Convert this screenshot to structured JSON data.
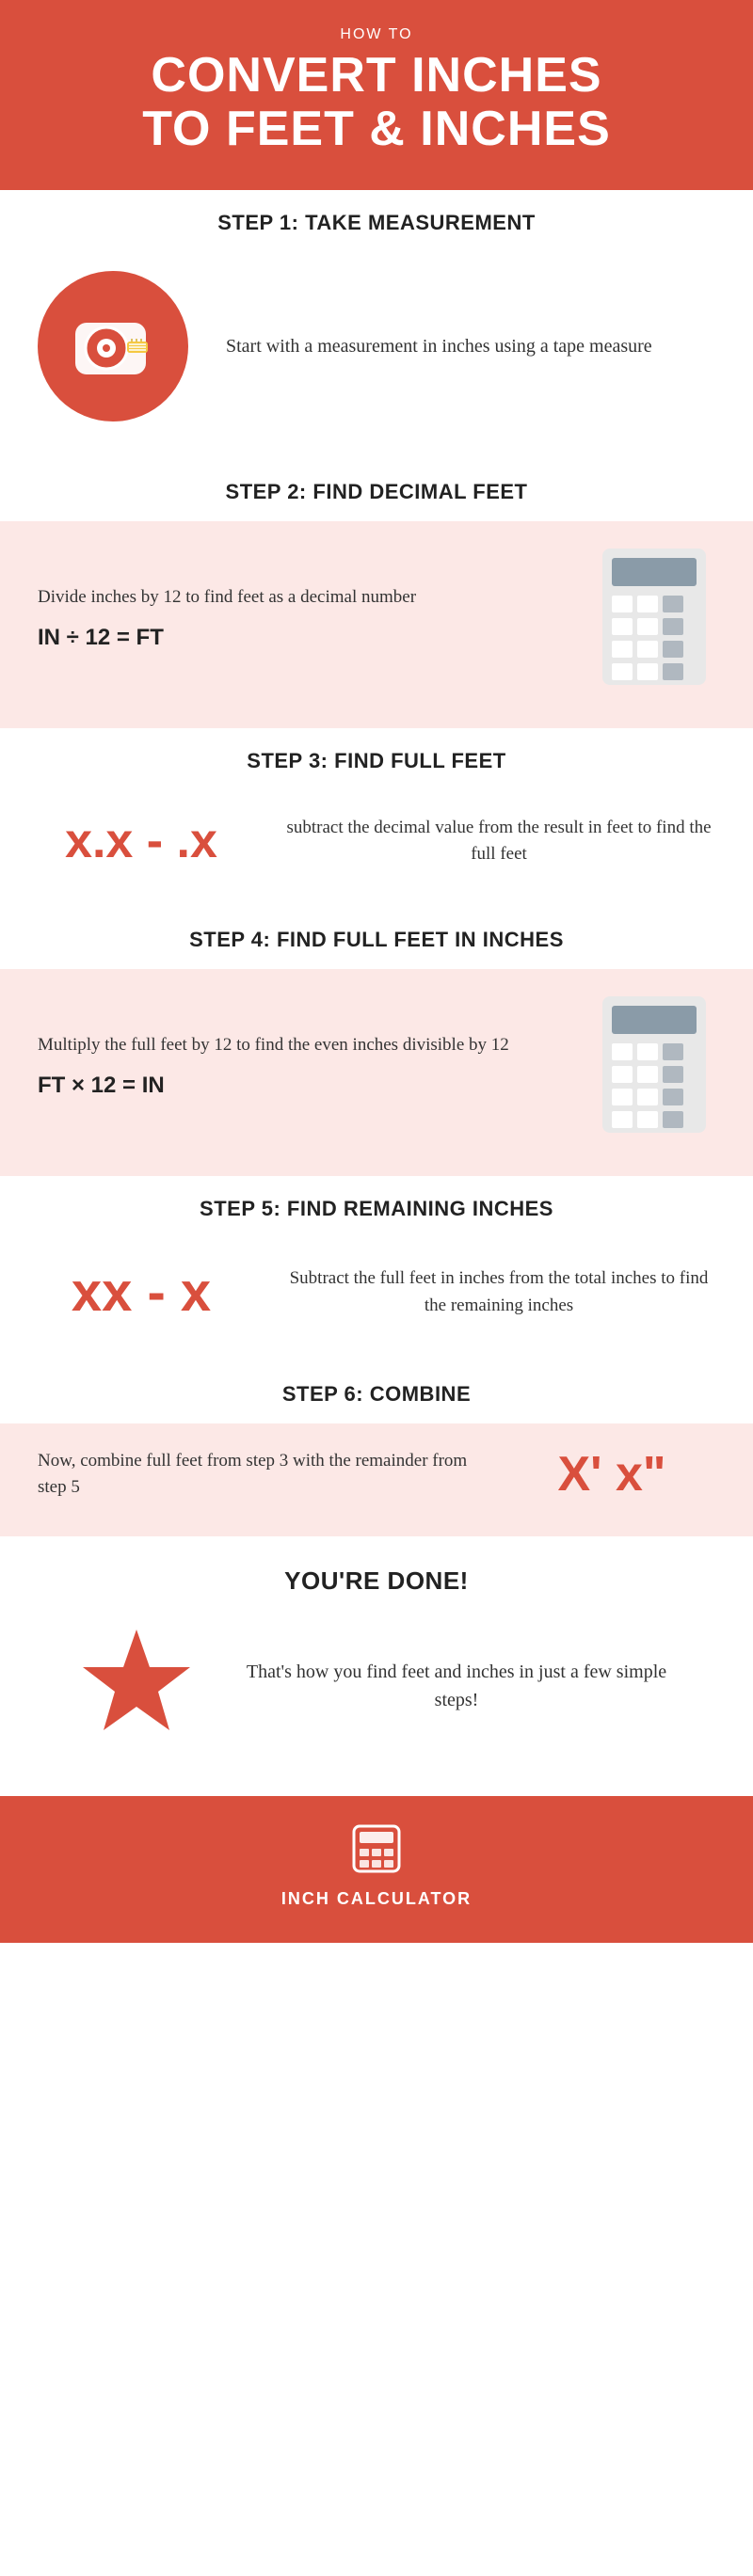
{
  "header": {
    "subtitle": "HOW TO",
    "title_line1": "CONVERT INCHES",
    "title_line2": "TO FEET & INCHES"
  },
  "steps": [
    {
      "number": "STEP 1:",
      "title": "TAKE MEASUREMENT",
      "body": "Start with a measurement in inches using a tape measure",
      "formula": null
    },
    {
      "number": "STEP 2:",
      "title": "FIND DECIMAL FEET",
      "body": "Divide inches by 12 to find feet as a decimal number",
      "formula": "IN ÷ 12 = FT"
    },
    {
      "number": "STEP 3:",
      "title": "FIND FULL FEET",
      "formula_display": "x.x - .x",
      "body": "subtract the decimal value from the result in feet to find the full feet"
    },
    {
      "number": "STEP 4:",
      "title": "FIND FULL FEET IN INCHES",
      "body": "Multiply the full feet by 12 to find the even inches divisible by 12",
      "formula": "FT × 12 = IN"
    },
    {
      "number": "STEP 5:",
      "title": "FIND REMAINING INCHES",
      "formula_display": "xx - x",
      "body": "Subtract the full feet in inches from the total inches to find the remaining inches"
    },
    {
      "number": "STEP 6:",
      "title": "COMBINE",
      "body": "Now, combine full feet from step 3 with the remainder from step 5",
      "formula_display": "X' x\""
    }
  ],
  "done": {
    "heading": "YOU'RE DONE!",
    "text": "That's how you find feet and inches in just a few simple steps!"
  },
  "footer": {
    "brand": "INCH CALCULATOR"
  }
}
